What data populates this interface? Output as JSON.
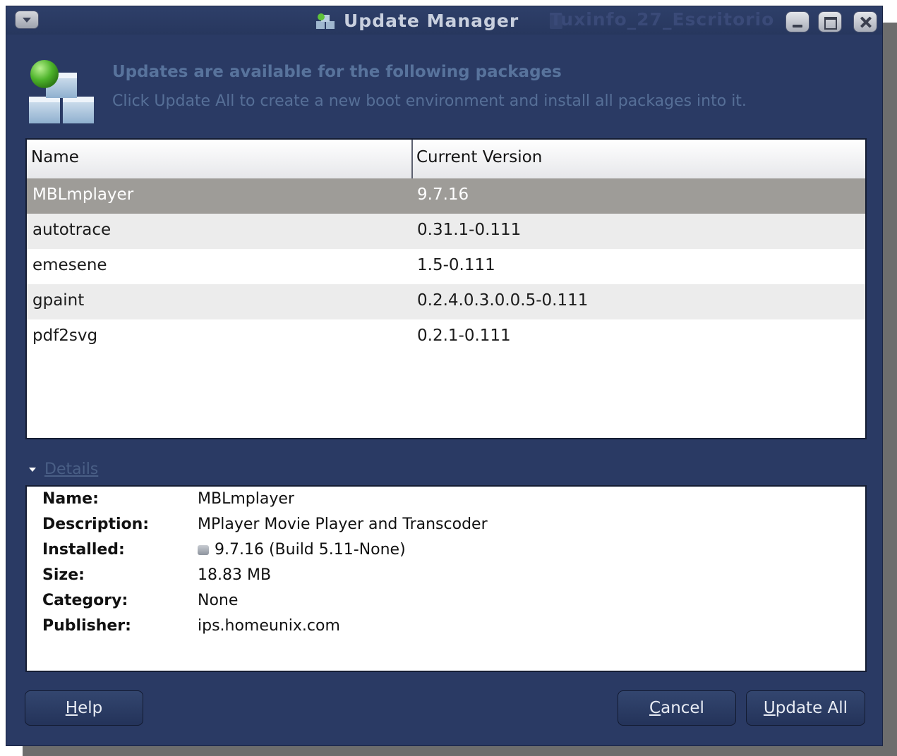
{
  "window": {
    "title": "Update Manager",
    "background_title": "Tuxinfo_27_Escritorio"
  },
  "header": {
    "heading": "Updates are available for the following packages",
    "subheading": "Click Update All to create a new boot environment and install all packages into it."
  },
  "list": {
    "columns": [
      "Name",
      "Current Version"
    ],
    "rows": [
      {
        "name": "MBLmplayer",
        "version": "9.7.16",
        "selected": true
      },
      {
        "name": "autotrace",
        "version": "0.31.1-0.111"
      },
      {
        "name": "emesene",
        "version": "1.5-0.111"
      },
      {
        "name": "gpaint",
        "version": "0.2.4.0.3.0.0.5-0.111"
      },
      {
        "name": "pdf2svg",
        "version": "0.2.1-0.111"
      }
    ]
  },
  "details": {
    "toggle_label": "Details",
    "fields": [
      {
        "label": "Name:",
        "value": "MBLmplayer"
      },
      {
        "label": "Description:",
        "value": "MPlayer Movie Player and Transcoder"
      },
      {
        "label": "Installed:",
        "value": "9.7.16 (Build 5.11-None)"
      },
      {
        "label": "Size:",
        "value": "18.83 MB"
      },
      {
        "label": "Category:",
        "value": "None"
      },
      {
        "label": "Publisher:",
        "value": "ips.homeunix.com"
      }
    ]
  },
  "buttons": {
    "help": {
      "mnemonic": "H",
      "rest": "elp"
    },
    "cancel": {
      "mnemonic": "C",
      "rest": "ancel"
    },
    "update_all": {
      "mnemonic": "U",
      "rest": "pdate All"
    }
  },
  "colors": {
    "window_bg": "#2a3a64",
    "selected_row": "#9e9c98",
    "alt_row": "#ececec",
    "heading": "#58739c"
  }
}
